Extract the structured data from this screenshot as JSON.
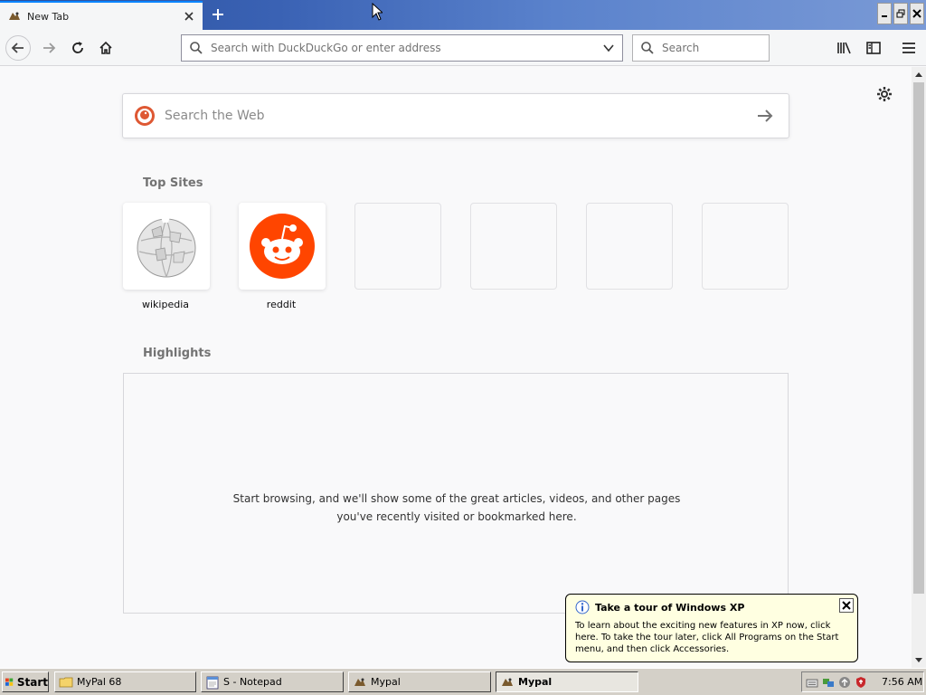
{
  "tab": {
    "title": "New Tab"
  },
  "navbar": {
    "url_placeholder": "Search with DuckDuckGo or enter address",
    "search_placeholder": "Search"
  },
  "content": {
    "web_search_placeholder": "Search the Web",
    "top_sites_title": "Top Sites",
    "top_sites": [
      {
        "label": "wikipedia",
        "icon": "wikipedia-icon"
      },
      {
        "label": "reddit",
        "icon": "reddit-icon"
      },
      {
        "label": "",
        "icon": ""
      },
      {
        "label": "",
        "icon": ""
      },
      {
        "label": "",
        "icon": ""
      },
      {
        "label": "",
        "icon": ""
      }
    ],
    "highlights_title": "Highlights",
    "highlights_message": "Start browsing, and we'll show some of the great articles, videos, and other pages you've recently visited or bookmarked here."
  },
  "balloon": {
    "title": "Take a tour of Windows XP",
    "body": "To learn about the exciting new features in XP now, click here. To take the tour later, click All Programs on the Start menu, and then click Accessories."
  },
  "taskbar": {
    "start_label": "Start",
    "buttons": [
      {
        "label": "MyPal 68",
        "icon": "folder-icon"
      },
      {
        "label": "S - Notepad",
        "icon": "notepad-icon"
      },
      {
        "label": "Mypal",
        "icon": "mypal-icon"
      },
      {
        "label": "Mypal",
        "icon": "mypal-icon",
        "active": true
      }
    ],
    "clock": "7:56 AM"
  },
  "colors": {
    "accent": "#0a84ff",
    "reddit": "#ff4500",
    "duckduckgo": "#de5833",
    "titlebar": "#3a62b4"
  }
}
